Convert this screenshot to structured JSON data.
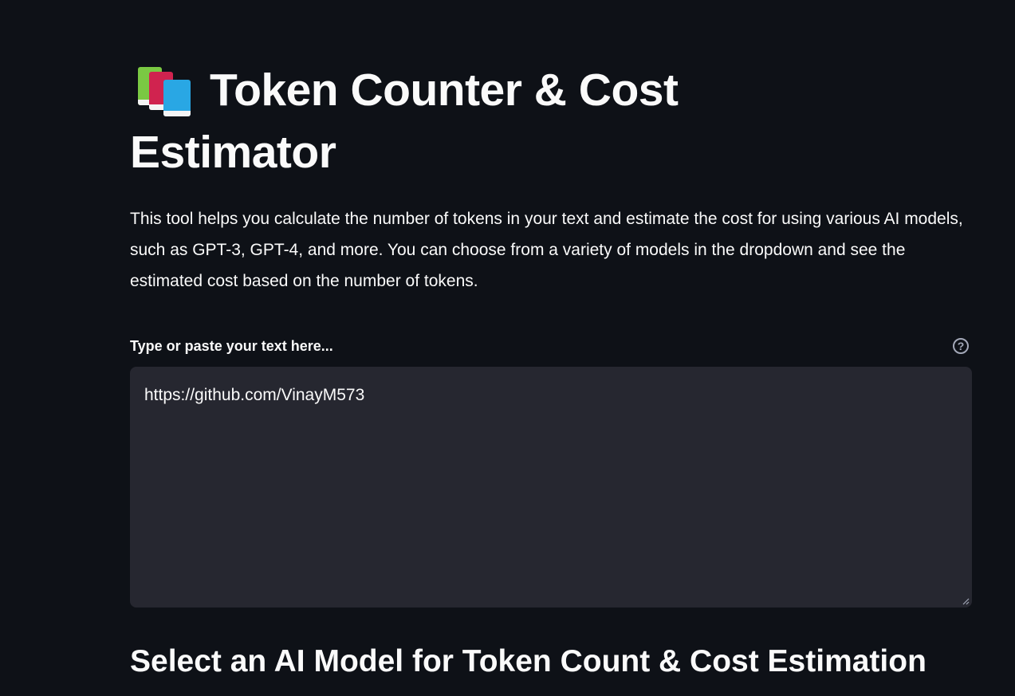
{
  "header": {
    "title": "Token Counter & Cost Estimator",
    "title_icon": "books-icon"
  },
  "intro": {
    "description": "This tool helps you calculate the number of tokens in your text and estimate the cost for using various AI models, such as GPT-3, GPT-4, and more. You can choose from a variety of models in the dropdown and see the estimated cost based on the number of tokens."
  },
  "text_input": {
    "label": "Type or paste your text here...",
    "value": "https://github.com/VinayM573",
    "help_icon": "help-circle-icon"
  },
  "model_section": {
    "heading": "Select an AI Model for Token Count & Cost Estimation"
  },
  "colors": {
    "background": "#0e1117",
    "text": "#fafafa",
    "input_background": "#262730",
    "muted_icon": "#a3a8b8"
  }
}
